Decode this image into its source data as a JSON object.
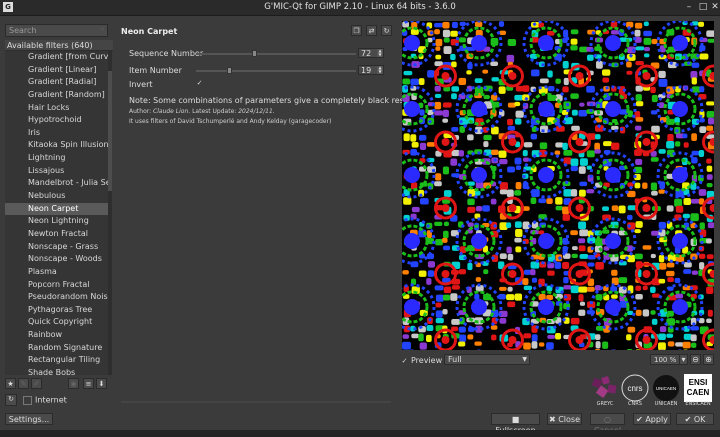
{
  "window": {
    "title": "G'MIC-Qt for GIMP 2.10 - Linux 64 bits - 3.6.0",
    "app_icon": "gmic-app-icon",
    "minimize": "–",
    "maximize": "□",
    "close": "✕"
  },
  "search": {
    "placeholder": "Search"
  },
  "filters": {
    "header": "Available filters (640)",
    "items": [
      "Gradient [from Curve]",
      "Gradient [Linear]",
      "Gradient [Radial]",
      "Gradient [Random]",
      "Hair Locks",
      "Hypotrochoid",
      "Iris",
      "Kitaoka Spin Illusion",
      "Lightning",
      "Lissajous",
      "Mandelbrot - Julia Sets",
      "Nebulous",
      "Neon Carpet",
      "Neon Lightning",
      "Newton Fractal",
      "Nonscape - Grass",
      "Nonscape - Woods",
      "Plasma",
      "Popcorn Fractal",
      "Pseudorandom Noise",
      "Pythagoras Tree",
      "Quick Copyright",
      "Rainbow",
      "Random Signature",
      "Rectangular Tiling",
      "Shade Bobs"
    ],
    "selected": "Neon Carpet"
  },
  "internet": {
    "label": "Internet"
  },
  "settings_label": "Settings...",
  "filter": {
    "title": "Neon Carpet",
    "params": {
      "sequence": {
        "label": "Sequence Number",
        "value": "72",
        "fraction": 0.36
      },
      "item": {
        "label": "Item Number",
        "value": "19",
        "fraction": 0.2
      },
      "invert": {
        "label": "Invert",
        "check": "✓"
      }
    },
    "note": "Note: Some combinations of parameters give a completely black result",
    "author_prefix": "Author: ",
    "author_name": "Claude Lion",
    "author_suffix": ". Latest Update: ",
    "update_date": "2024/12/11",
    "uses": "It uses filters of David Tschumperlé and Andy Kelday (garagecoder)"
  },
  "preview": {
    "label": "Preview",
    "check": "✓",
    "mode": "Full",
    "zoom": "100 %"
  },
  "logos": [
    "GREYC",
    "CNRS",
    "UNICAEN",
    "ENSICAEN"
  ],
  "logo_text": {
    "cnrs": "cnrs",
    "unicaen": "UNICAEN",
    "ensi": "ENSI",
    "caen": "CAEN"
  },
  "buttons": {
    "fullscreen": "Fullscreen",
    "close": "Close",
    "cancel": "Cancel",
    "apply": "Apply",
    "ok": "OK"
  }
}
